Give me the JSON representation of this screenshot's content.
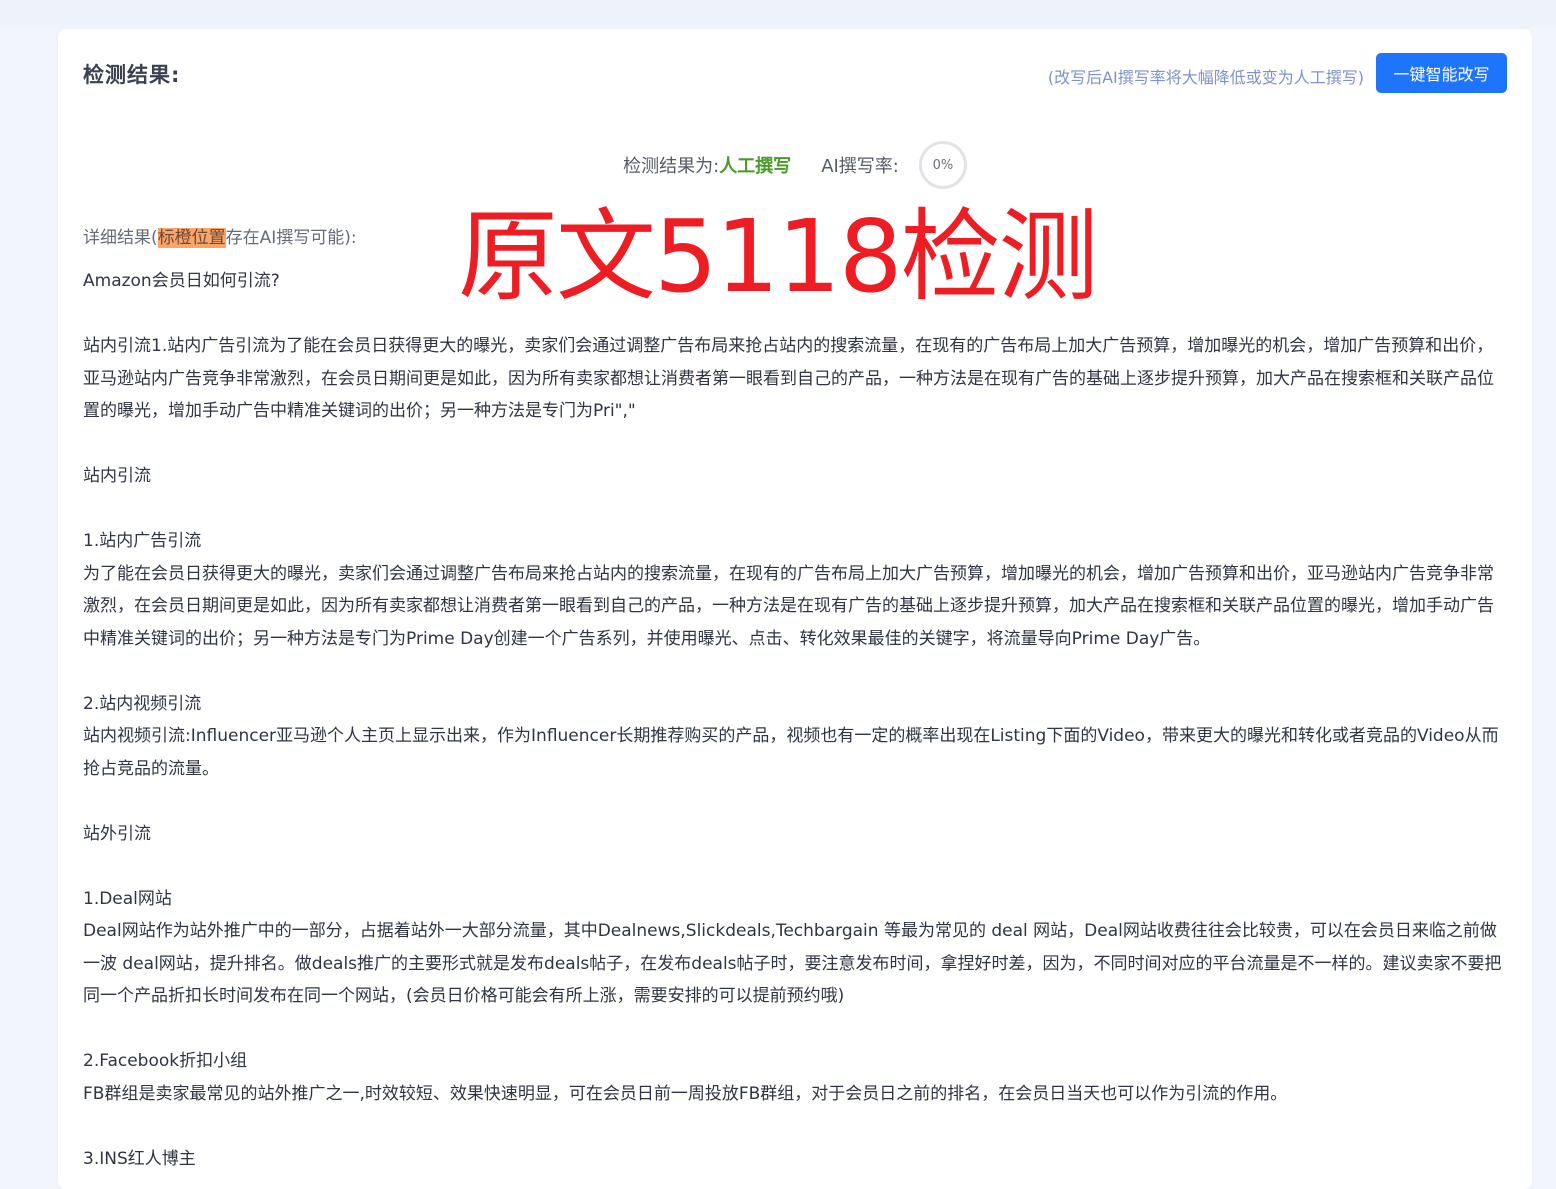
{
  "header": {
    "title": "检测结果:",
    "rewrite_hint": "(改写后AI撰写率将大幅降低或变为人工撰写)",
    "rewrite_button": "一键智能改写"
  },
  "result": {
    "label": "检测结果为:",
    "value": "人工撰写",
    "ai_rate_label": "AI撰写率:",
    "ai_rate_value": "0%",
    "colors": {
      "value": "#4a9a2a",
      "accent_button": "#1e74fb",
      "highlight": "#f9a468"
    }
  },
  "detail": {
    "prefix": "详细结果(",
    "highlight": "标橙位置",
    "suffix": "存在AI撰写可能):"
  },
  "watermark": "原文5118检测",
  "content": {
    "title": "Amazon会员日如何引流?",
    "p1": "站内引流1.站内广告引流为了能在会员日获得更大的曝光，卖家们会通过调整广告布局来抢占站内的搜索流量，在现有的广告布局上加大广告预算，增加曝光的机会，增加广告预算和出价，亚马逊站内广告竞争非常激烈，在会员日期间更是如此，因为所有卖家都想让消费者第一眼看到自己的产品，一种方法是在现有广告的基础上逐步提升预算，加大产品在搜索框和关联产品位置的曝光，增加手动广告中精准关键词的出价；另一种方法是专门为Pri\",\"",
    "s_in": "站内引流",
    "h1": "1.站内广告引流",
    "p2": "为了能在会员日获得更大的曝光，卖家们会通过调整广告布局来抢占站内的搜索流量，在现有的广告布局上加大广告预算，增加曝光的机会，增加广告预算和出价，亚马逊站内广告竞争非常激烈，在会员日期间更是如此，因为所有卖家都想让消费者第一眼看到自己的产品，一种方法是在现有广告的基础上逐步提升预算，加大产品在搜索框和关联产品位置的曝光，增加手动广告中精准关键词的出价；另一种方法是专门为Prime Day创建一个广告系列，并使用曝光、点击、转化效果最佳的关键字，将流量导向Prime Day广告。",
    "h2": "2.站内视频引流",
    "p3": "站内视频引流:Influencer亚马逊个人主页上显示出来，作为Influencer长期推荐购买的产品，视频也有一定的概率出现在Listing下面的Video，带来更大的曝光和转化或者竞品的Video从而抢占竞品的流量。",
    "s_out": "站外引流",
    "h3": "1.Deal网站",
    "p4": "Deal网站作为站外推广中的一部分，占据着站外一大部分流量，其中Dealnews,Slickdeals,Techbargain 等最为常见的 deal 网站，Deal网站收费往往会比较贵，可以在会员日来临之前做一波 deal网站，提升排名。做deals推广的主要形式就是发布deals帖子，在发布deals帖子时，要注意发布时间，拿捏好时差，因为，不同时间对应的平台流量是不一样的。建议卖家不要把同一个产品折扣长时间发布在同一个网站，(会员日价格可能会有所上涨，需要安排的可以提前预约哦)",
    "h4": "2.Facebook折扣小组",
    "p5": "FB群组是卖家最常见的站外推广之一,时效较短、效果快速明显，可在会员日前一周投放FB群组，对于会员日之前的排名，在会员日当天也可以作为引流的作用。",
    "h5": "3.INS红人博主"
  }
}
